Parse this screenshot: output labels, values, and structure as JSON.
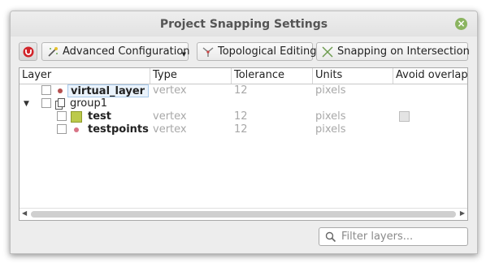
{
  "window": {
    "title": "Project Snapping Settings",
    "close_icon": "close-icon"
  },
  "toolbar": {
    "magnet_icon": "magnet-icon",
    "advanced_configuration_label": "Advanced Configuration",
    "topological_editing_label": "Topological Editing",
    "snapping_on_intersection_label": "Snapping on Intersection"
  },
  "tree": {
    "columns": [
      "Layer",
      "Type",
      "Tolerance",
      "Units",
      "Avoid overlap"
    ],
    "rows": [
      {
        "name": "virtual_layer",
        "type": "vertex",
        "tolerance": "12",
        "units": "pixels",
        "icon": "point-layer-icon"
      },
      {
        "name": "group1",
        "icon": "group-icon"
      },
      {
        "name": "test",
        "type": "vertex",
        "tolerance": "12",
        "units": "pixels",
        "icon": "polygon-layer-icon"
      },
      {
        "name": "testpoints",
        "type": "vertex",
        "tolerance": "12",
        "units": "pixels",
        "icon": "point-layer-icon"
      }
    ]
  },
  "filter": {
    "placeholder": "Filter layers..."
  },
  "colors": {
    "point_symbol": "#b5504f",
    "polygon_symbol": "#bcca4b",
    "selection": "#eaf3fc",
    "close_button": "#8bb460"
  }
}
